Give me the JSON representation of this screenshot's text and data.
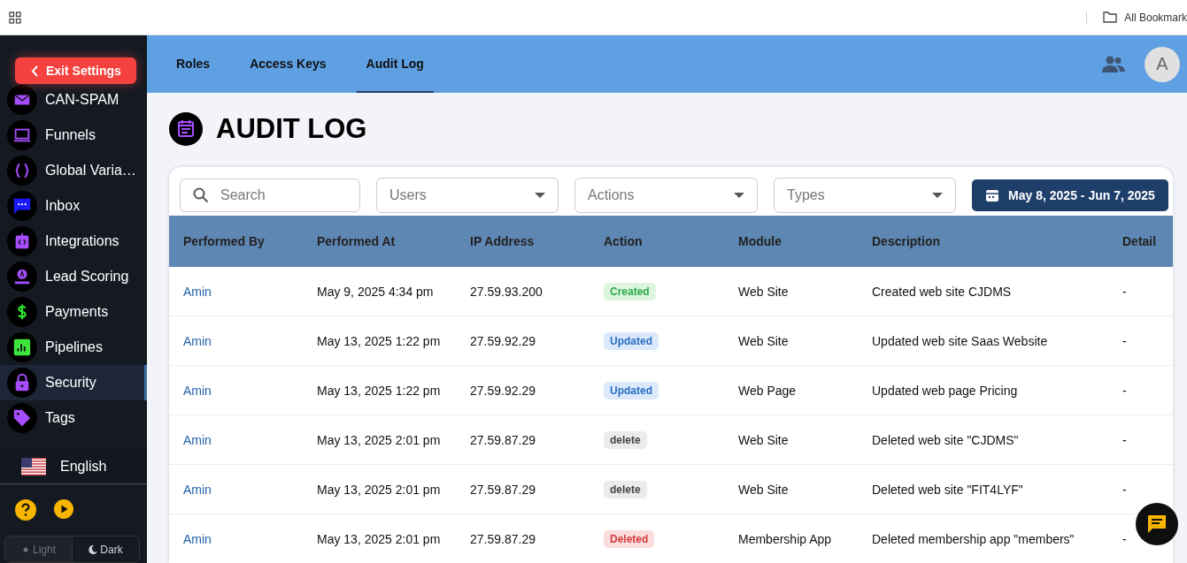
{
  "browser_bar": {
    "bookmarks_label": "All Bookmark"
  },
  "sidebar": {
    "exit_button": "Exit Settings",
    "items": [
      {
        "label": "CAN-SPAM",
        "selected": false
      },
      {
        "label": "Funnels",
        "selected": false
      },
      {
        "label": "Global Varia…",
        "selected": false
      },
      {
        "label": "Inbox",
        "selected": false
      },
      {
        "label": "Integrations",
        "selected": false
      },
      {
        "label": "Lead Scoring",
        "selected": false
      },
      {
        "label": "Payments",
        "selected": false
      },
      {
        "label": "Pipelines",
        "selected": false
      },
      {
        "label": "Security",
        "selected": true
      },
      {
        "label": "Tags",
        "selected": false
      }
    ],
    "language": "English",
    "theme_options": [
      {
        "label": "Light",
        "selected": false
      },
      {
        "label": "Dark",
        "selected": true
      }
    ]
  },
  "tabs": [
    {
      "label": "Roles",
      "selected": false
    },
    {
      "label": "Access Keys",
      "selected": false
    },
    {
      "label": "Audit Log",
      "selected": true
    }
  ],
  "avatar": "A",
  "page_title": "AUDIT LOG",
  "filters": {
    "search": {
      "placeholder": "Search"
    },
    "dropdowns": [
      {
        "placeholder": "Users"
      },
      {
        "placeholder": "Actions"
      },
      {
        "placeholder": "Types"
      }
    ],
    "date_range": "May 8, 2025 - Jun 7, 2025"
  },
  "table": {
    "columns": [
      "Performed By",
      "Performed At",
      "IP Address",
      "Action",
      "Module",
      "Description",
      "Detail"
    ],
    "rows": [
      {
        "user": "Amin",
        "time": "May 9, 2025 4:34 pm",
        "ip": "27.59.93.200",
        "action": {
          "label": "Created",
          "kind": "created"
        },
        "module": "Web Site",
        "description": "Created web site CJDMS",
        "detail": "-"
      },
      {
        "user": "Amin",
        "time": "May 13, 2025 1:22 pm",
        "ip": "27.59.92.29",
        "action": {
          "label": "Updated",
          "kind": "updated"
        },
        "module": "Web Site",
        "description": "Updated web site Saas Website",
        "detail": "-"
      },
      {
        "user": "Amin",
        "time": "May 13, 2025 1:22 pm",
        "ip": "27.59.92.29",
        "action": {
          "label": "Updated",
          "kind": "updated"
        },
        "module": "Web Page",
        "description": "Updated web page Pricing",
        "detail": "-"
      },
      {
        "user": "Amin",
        "time": "May 13, 2025 2:01 pm",
        "ip": "27.59.87.29",
        "action": {
          "label": "delete",
          "kind": "neutral"
        },
        "module": "Web Site",
        "description": "Deleted web site \"CJDMS\"",
        "detail": "-"
      },
      {
        "user": "Amin",
        "time": "May 13, 2025 2:01 pm",
        "ip": "27.59.87.29",
        "action": {
          "label": "delete",
          "kind": "neutral"
        },
        "module": "Web Site",
        "description": "Deleted web site \"FIT4LYF\"",
        "detail": "-"
      },
      {
        "user": "Amin",
        "time": "May 13, 2025 2:01 pm",
        "ip": "27.59.87.29",
        "action": {
          "label": "Deleted",
          "kind": "deleted"
        },
        "module": "Membership App",
        "description": "Deleted membership app \"members\"",
        "detail": "-"
      }
    ]
  }
}
